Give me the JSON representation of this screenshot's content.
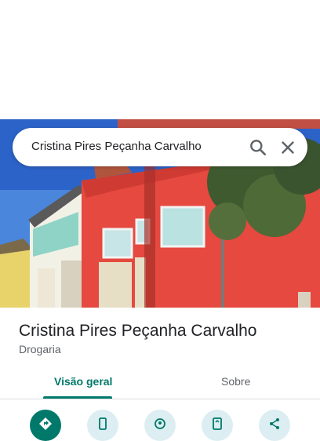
{
  "search": {
    "query": "Cristina Pires Peçanha Carvalho"
  },
  "place": {
    "name": "Cristina Pires Peçanha Carvalho",
    "category": "Drogaria"
  },
  "tabs": [
    {
      "label": "Visão geral",
      "selected": true
    },
    {
      "label": "Sobre",
      "selected": false
    }
  ],
  "actions": [
    {
      "icon": "directions-icon"
    },
    {
      "icon": "phone-icon"
    },
    {
      "icon": "nearby-icon"
    },
    {
      "icon": "send-to-phone-icon"
    },
    {
      "icon": "share-icon"
    }
  ],
  "colors": {
    "accent": "#00796b",
    "action_bg": "#dceef2",
    "building_red": "#e5493f"
  }
}
